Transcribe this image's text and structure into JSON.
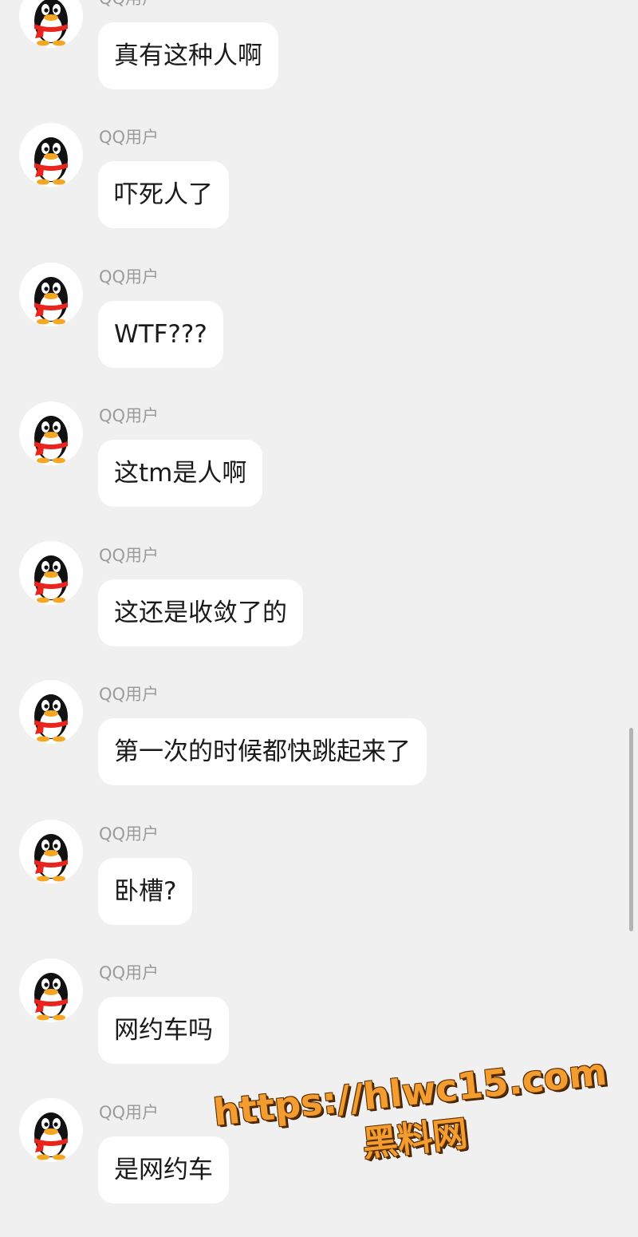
{
  "messages": [
    {
      "sender": "QQ用户",
      "text": "真有这种人啊"
    },
    {
      "sender": "QQ用户",
      "text": "吓死人了"
    },
    {
      "sender": "QQ用户",
      "text": "WTF???"
    },
    {
      "sender": "QQ用户",
      "text": "这tm是人啊"
    },
    {
      "sender": "QQ用户",
      "text": "这还是收敛了的"
    },
    {
      "sender": "QQ用户",
      "text": "第一次的时候都快跳起来了"
    },
    {
      "sender": "QQ用户",
      "text": "卧槽?"
    },
    {
      "sender": "QQ用户",
      "text": "网约车吗"
    },
    {
      "sender": "QQ用户",
      "text": "是网约车"
    }
  ],
  "avatar_icon": "qq-penguin-icon",
  "watermark": {
    "url": "https://hlwc15.com",
    "name": "黑料网",
    "color": "#f39c2f"
  }
}
